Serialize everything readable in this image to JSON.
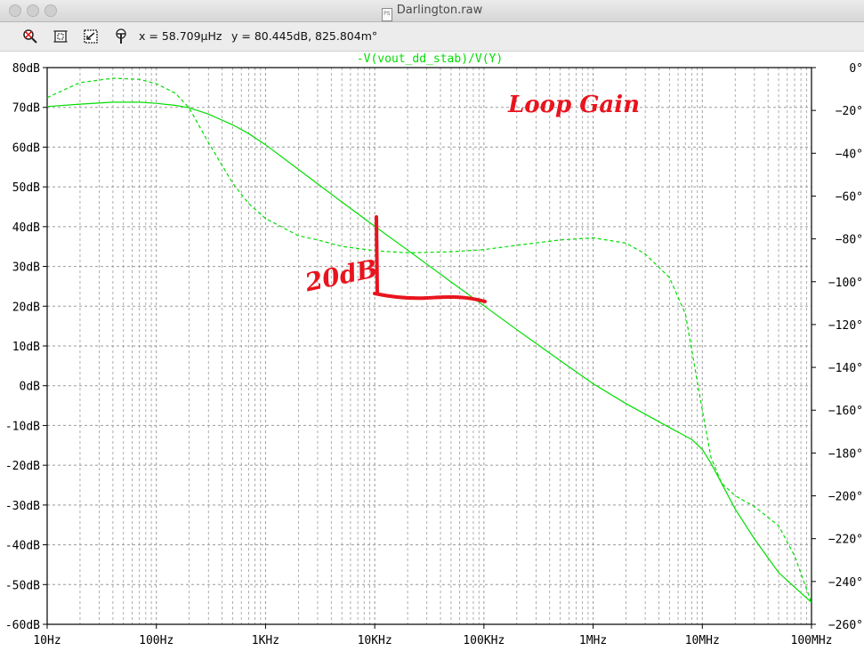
{
  "window": {
    "title": "Darlington.raw",
    "file_icon_text": "PS"
  },
  "toolbar": {
    "tools": [
      "zoom-full-icon",
      "zoom-box-icon",
      "zoom-back-icon",
      "probe-cursor-icon"
    ],
    "cursor_x": "x = 58.709µHz",
    "cursor_y": "y = 80.445dB, 825.804m°"
  },
  "annotation": {
    "title": "Loop Gain",
    "slope_label": "20dB"
  },
  "colors": {
    "trace": "#00dd00",
    "annotation": "#e8141e",
    "grid": "#9a9a9a",
    "axis_text": "#000000"
  },
  "chart_data": {
    "type": "line",
    "title": "-V(vout_dd_stab)/V(Y)",
    "xscale": "log",
    "xlim": [
      10,
      100000000
    ],
    "x_ticks": [
      10,
      100,
      1000,
      10000,
      100000,
      1000000,
      10000000,
      100000000
    ],
    "x_tick_labels": [
      "10Hz",
      "100Hz",
      "1KHz",
      "10KHz",
      "100KHz",
      "1MHz",
      "10MHz",
      "100MHz"
    ],
    "ylim": [
      -60,
      80
    ],
    "y_ticks": [
      80,
      70,
      60,
      50,
      40,
      30,
      20,
      10,
      0,
      -10,
      -20,
      -30,
      -40,
      -50,
      -60
    ],
    "y_tick_labels": [
      "80dB",
      "70dB",
      "60dB",
      "50dB",
      "40dB",
      "30dB",
      "20dB",
      "10dB",
      "0dB",
      "-10dB",
      "-20dB",
      "-30dB",
      "-40dB",
      "-50dB",
      "-60dB"
    ],
    "y2lim": [
      -260,
      0
    ],
    "y2_ticks": [
      0,
      -20,
      -40,
      -60,
      -80,
      -100,
      -120,
      -140,
      -160,
      -180,
      -200,
      -220,
      -240,
      -260
    ],
    "y2_tick_labels": [
      "0°",
      "−20°",
      "−40°",
      "−60°",
      "−80°",
      "−100°",
      "−120°",
      "−140°",
      "−160°",
      "−180°",
      "−200°",
      "−220°",
      "−240°",
      "−260°"
    ],
    "grid": true,
    "series": [
      {
        "axis": "left",
        "style": "solid",
        "x": [
          10,
          20,
          40,
          70,
          100,
          150,
          200,
          300,
          500,
          700,
          1000,
          2000,
          5000,
          10000,
          20000,
          50000,
          100000,
          200000,
          500000,
          1000000,
          2000000,
          5000000,
          8000000,
          10000000,
          12000000,
          15000000,
          20000000,
          30000000,
          50000000,
          100000000
        ],
        "y": [
          70.2,
          70.8,
          71.3,
          71.3,
          71.0,
          70.5,
          69.9,
          68.3,
          65.6,
          63.4,
          60.6,
          54.4,
          46.2,
          40.1,
          34.1,
          26.1,
          20.1,
          14.1,
          6.3,
          0.5,
          -4.5,
          -10.5,
          -13.5,
          -16.0,
          -19.5,
          -24.5,
          -31.0,
          -38.5,
          -47.0,
          -54.5
        ]
      },
      {
        "axis": "right",
        "style": "dashed",
        "x": [
          10,
          20,
          40,
          70,
          100,
          150,
          200,
          300,
          500,
          700,
          1000,
          2000,
          3000,
          5000,
          10000,
          20000,
          50000,
          100000,
          200000,
          500000,
          1000000,
          2000000,
          3000000,
          5000000,
          7000000,
          10000000,
          12000000,
          15000000,
          20000000,
          30000000,
          50000000,
          70000000,
          100000000
        ],
        "y": [
          -14,
          -7,
          -5,
          -5.5,
          -7.5,
          -12,
          -19,
          -35,
          -54,
          -63.5,
          -70.5,
          -78.5,
          -80.5,
          -83.5,
          -85.5,
          -86.5,
          -86,
          -85,
          -83,
          -80.5,
          -79.5,
          -82,
          -87,
          -98,
          -115,
          -160,
          -182,
          -194,
          -200,
          -205,
          -214,
          -228,
          -250
        ]
      }
    ]
  }
}
